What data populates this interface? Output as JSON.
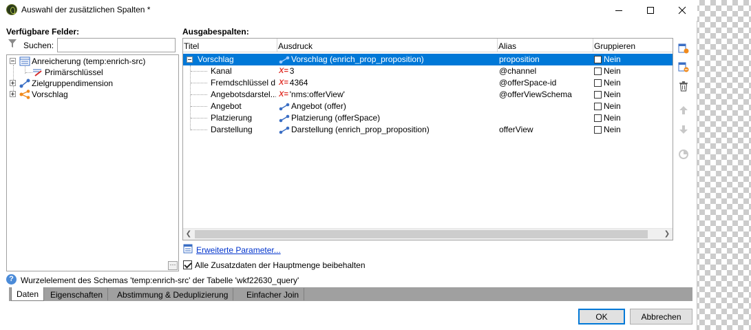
{
  "window": {
    "title": "Auswahl der zusätzlichen Spalten *"
  },
  "left": {
    "heading": "Verfügbare Felder:",
    "search_label": "Suchen:",
    "search_value": "",
    "tree": [
      {
        "label": "Anreicherung (temp:enrich-src)",
        "expanded": true,
        "icon": "table-icon"
      },
      {
        "label": "Primärschlüssel",
        "icon": "primary-key-icon"
      },
      {
        "label": "Zielgruppendimension",
        "expanded": false,
        "icon": "link-icon"
      },
      {
        "label": "Vorschlag",
        "expanded": false,
        "icon": "collection-icon"
      }
    ]
  },
  "grid": {
    "heading": "Ausgabespalten:",
    "columns": [
      "Titel",
      "Ausdruck",
      "Alias",
      "Gruppieren"
    ],
    "rows": [
      {
        "title": "Vorschlag",
        "expression": "Vorschlag (enrich_prop_proposition)",
        "expr_icon": "link-icon",
        "alias": "proposition",
        "group": "Nein",
        "selected": true
      },
      {
        "title": "Kanal",
        "expression": "3",
        "expr_icon": "expression-icon",
        "alias": "@channel",
        "group": "Nein"
      },
      {
        "title": "Fremdschlüssel d...",
        "expression": "4364",
        "expr_icon": "expression-icon",
        "alias": "@offerSpace-id",
        "group": "Nein"
      },
      {
        "title": "Angebotsdarstel...",
        "expression": "'nms:offerView'",
        "expr_icon": "expression-icon",
        "alias": "@offerViewSchema",
        "group": "Nein"
      },
      {
        "title": "Angebot",
        "expression": "Angebot (offer)",
        "expr_icon": "link-icon",
        "alias": "",
        "group": "Nein"
      },
      {
        "title": "Platzierung",
        "expression": "Platzierung (offerSpace)",
        "expr_icon": "link-icon",
        "alias": "",
        "group": "Nein"
      },
      {
        "title": "Darstellung",
        "expression": "Darstellung (enrich_prop_proposition)",
        "expr_icon": "link-icon",
        "alias": "offerView",
        "group": "Nein"
      }
    ]
  },
  "advanced_link": "Erweiterte Parameter...",
  "keep_checkbox": {
    "label": "Alle Zusatzdaten der Hauptmenge beibehalten",
    "checked": true
  },
  "status": "Wurzelelement des Schemas 'temp:enrich-src' der Tabelle 'wkf22630_query'",
  "tabs": [
    "Daten",
    "Eigenschaften",
    "Abstimmung & Deduplizierung",
    "Einfacher Join"
  ],
  "buttons": {
    "ok": "OK",
    "cancel": "Abbrechen"
  },
  "colors": {
    "selection": "#0078d7",
    "link": "#0033cc",
    "expression": "#e0332b"
  }
}
